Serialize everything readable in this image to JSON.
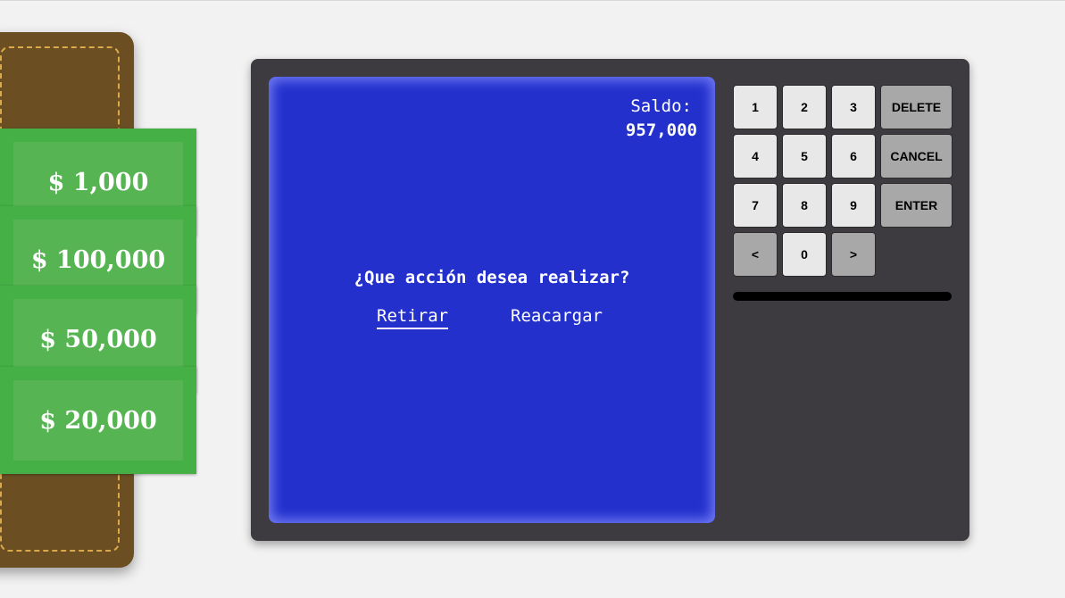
{
  "wallet": {
    "bills": [
      {
        "label": "$ 1,000"
      },
      {
        "label": "$ 100,000"
      },
      {
        "label": "$ 50,000"
      },
      {
        "label": "$ 20,000"
      }
    ]
  },
  "atm": {
    "screen": {
      "balance_label": "Saldo:",
      "balance_value": "957,000",
      "question": "¿Que acción desea realizar?",
      "options": [
        {
          "label": "Retirar",
          "selected": true
        },
        {
          "label": "Reacargar",
          "selected": false
        }
      ]
    },
    "keypad": {
      "k1": "1",
      "k2": "2",
      "k3": "3",
      "delete": "DELETE",
      "k4": "4",
      "k5": "5",
      "k6": "6",
      "cancel": "CANCEL",
      "k7": "7",
      "k8": "8",
      "k9": "9",
      "enter": "ENTER",
      "prev": "<",
      "k0": "0",
      "next": ">"
    }
  },
  "colors": {
    "screen": "#2330cc",
    "bill": "#44b046",
    "wallet": "#6b4f23",
    "atm_body": "#3d3b40"
  }
}
